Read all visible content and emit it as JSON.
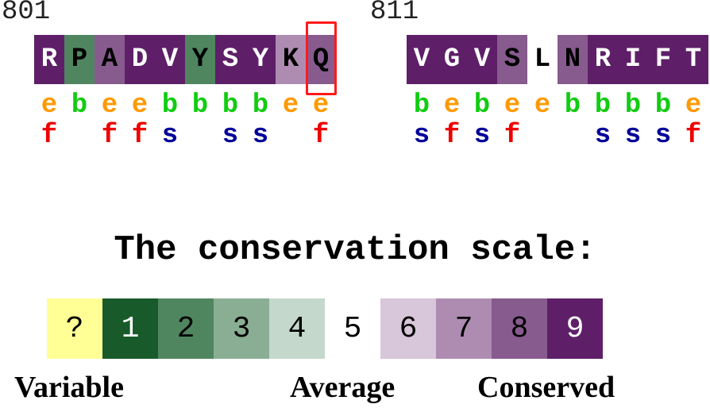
{
  "palette": {
    "?": "#ffff96",
    "1": "#195a2b",
    "2": "#4f8660",
    "3": "#8aae93",
    "4": "#c4d8cc",
    "5": "#ffffff",
    "6": "#d8c6da",
    "7": "#ae8cb2",
    "8": "#875b8e",
    "9": "#5e1f68"
  },
  "exposure_colors": {
    "e": "#ff9900",
    "b": "#11cc11"
  },
  "function_colors": {
    "f": "#ee0000",
    "s": "#000099"
  },
  "blocks": [
    {
      "start_label": "801",
      "residues": [
        {
          "aa": "R",
          "grade": "9",
          "text_color": "#ffffff",
          "exposure": "e",
          "function": "f"
        },
        {
          "aa": "P",
          "grade": "2",
          "text_color": "#000000",
          "exposure": "b",
          "function": ""
        },
        {
          "aa": "A",
          "grade": "8",
          "text_color": "#000000",
          "exposure": "e",
          "function": "f"
        },
        {
          "aa": "D",
          "grade": "9",
          "text_color": "#ffffff",
          "exposure": "e",
          "function": "f"
        },
        {
          "aa": "V",
          "grade": "9",
          "text_color": "#ffffff",
          "exposure": "b",
          "function": "s"
        },
        {
          "aa": "Y",
          "grade": "2",
          "text_color": "#000000",
          "exposure": "b",
          "function": ""
        },
        {
          "aa": "S",
          "grade": "9",
          "text_color": "#ffffff",
          "exposure": "b",
          "function": "s"
        },
        {
          "aa": "Y",
          "grade": "9",
          "text_color": "#ffffff",
          "exposure": "b",
          "function": "s"
        },
        {
          "aa": "K",
          "grade": "7",
          "text_color": "#000000",
          "exposure": "e",
          "function": ""
        },
        {
          "aa": "Q",
          "grade": "8",
          "text_color": "#000000",
          "exposure": "e",
          "function": "f"
        }
      ]
    },
    {
      "start_label": "811",
      "residues": [
        {
          "aa": "V",
          "grade": "9",
          "text_color": "#ffffff",
          "exposure": "b",
          "function": "s"
        },
        {
          "aa": "G",
          "grade": "9",
          "text_color": "#ffffff",
          "exposure": "e",
          "function": "f"
        },
        {
          "aa": "V",
          "grade": "9",
          "text_color": "#ffffff",
          "exposure": "b",
          "function": "s"
        },
        {
          "aa": "S",
          "grade": "8",
          "text_color": "#000000",
          "exposure": "e",
          "function": "f"
        },
        {
          "aa": "L",
          "grade": "5",
          "text_color": "#000000",
          "exposure": "e",
          "function": ""
        },
        {
          "aa": "N",
          "grade": "8",
          "text_color": "#000000",
          "exposure": "b",
          "function": ""
        },
        {
          "aa": "R",
          "grade": "9",
          "text_color": "#ffffff",
          "exposure": "b",
          "function": "s"
        },
        {
          "aa": "I",
          "grade": "9",
          "text_color": "#ffffff",
          "exposure": "b",
          "function": "s"
        },
        {
          "aa": "F",
          "grade": "9",
          "text_color": "#ffffff",
          "exposure": "b",
          "function": "s"
        },
        {
          "aa": "T",
          "grade": "9",
          "text_color": "#ffffff",
          "exposure": "e",
          "function": "f"
        }
      ]
    }
  ],
  "highlighted_residue": {
    "block": 0,
    "index": 9,
    "aa": "Q",
    "box_color": "#ff1a1a"
  },
  "scale": {
    "title": "The conservation scale:",
    "cells": [
      {
        "label": "?",
        "text_color": "#000000"
      },
      {
        "label": "1",
        "text_color": "#ffffff"
      },
      {
        "label": "2",
        "text_color": "#000000"
      },
      {
        "label": "3",
        "text_color": "#000000"
      },
      {
        "label": "4",
        "text_color": "#000000"
      },
      {
        "label": "5",
        "text_color": "#000000"
      },
      {
        "label": "6",
        "text_color": "#000000"
      },
      {
        "label": "7",
        "text_color": "#000000"
      },
      {
        "label": "8",
        "text_color": "#000000"
      },
      {
        "label": "9",
        "text_color": "#ffffff"
      }
    ],
    "labels": {
      "variable": "Variable",
      "average": "Average",
      "conserved": "Conserved"
    }
  }
}
